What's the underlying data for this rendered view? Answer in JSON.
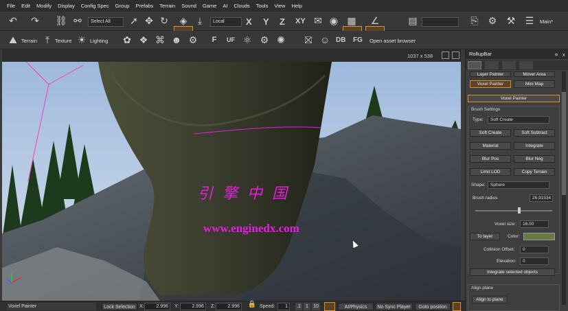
{
  "menu": [
    "File",
    "Edit",
    "Modify",
    "Display",
    "Config Spec",
    "Group",
    "Prefabs",
    "Terrain",
    "Sound",
    "Game",
    "AI",
    "Clouds",
    "Tools",
    "View",
    "Help"
  ],
  "toolbar": {
    "select_filter": "Select All",
    "coord_system": "Local",
    "axis_x": "X",
    "axis_y": "Y",
    "axis_z": "Z",
    "axis_xy": "XY",
    "layer_name": "Main*"
  },
  "toolbar2": {
    "terrain": "Terrain",
    "texture": "Texture",
    "lighting": "Lighting",
    "db": "DB",
    "fg": "FG",
    "asset_browser": "Open asset browser"
  },
  "viewport": {
    "resolution": "1037 x 538",
    "watermark_cn": "引擎中国",
    "watermark_url": "www.enginedx.com"
  },
  "status": {
    "mode": "Voxel Painter",
    "lock": "Lock Selection",
    "x_label": "X:",
    "x": "2.996",
    "y_label": "Y:",
    "y": "2.996",
    "z_label": "Z:",
    "z": "2.996",
    "speed_label": "Speed:",
    "speed": "1",
    "speed_01": ".1",
    "speed_1": "1",
    "speed_10": "10",
    "ai": "AI/Physics",
    "sync": "No Sync Player",
    "goto": "Goto position"
  },
  "rollup": {
    "title": "RollupBar",
    "close": "x",
    "pin": "¤",
    "top_btns": [
      "Layer Painter",
      "Mover Area"
    ],
    "voxel_btn": "Voxel Painter",
    "minimap_btn": "Mini Map",
    "section": "Voxel Painter",
    "brush_settings": "Brush Settings",
    "type_label": "Type:",
    "type_value": "Soft Create",
    "buttons": [
      [
        "Soft Create",
        "Soft Subtract"
      ],
      [
        "Material",
        "Integrate"
      ],
      [
        "Blur Pos",
        "Blur Neg"
      ],
      [
        "Limit LOD",
        "Copy Terrain"
      ]
    ],
    "shape_label": "Shape:",
    "shape_value": "Sphere",
    "brush_radius_label": "Brush radius",
    "brush_radius": "26.91534",
    "voxel_size_label": "Voxel size:",
    "voxel_size": "16.00",
    "to_layer": "To layer",
    "color_label": "Color:",
    "color_value": "#6b7a45",
    "collision_label": "Collision Offset:",
    "collision": "0",
    "elevation_label": "Elevation:",
    "elevation": "0",
    "integrate_selected": "Integrate selected objects",
    "align_plane": "Align plane",
    "align_to_plane": "Align to plane"
  },
  "colors": {
    "accent": "#e0902a",
    "watermark": "#e81ee0"
  }
}
